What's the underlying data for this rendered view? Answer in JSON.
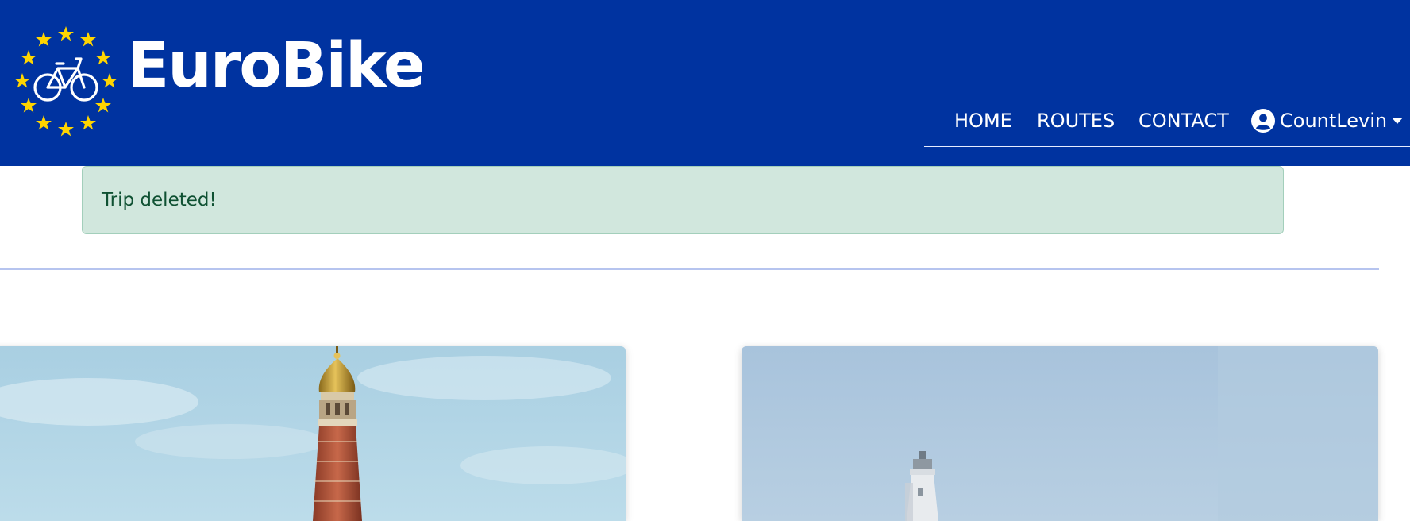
{
  "brand": {
    "name": "EuroBike",
    "logo_icon": "bicycle-in-eu-stars-icon",
    "colors": {
      "header_bg": "#0033a0",
      "stars": "#ffd500"
    }
  },
  "nav": {
    "home": "HOME",
    "routes": "ROUTES",
    "contact": "CONTACT",
    "user_name": "CountLevin",
    "user_icon": "user-circle-icon",
    "dropdown_icon": "caret-down-icon"
  },
  "alert": {
    "message": "Trip deleted!",
    "colors": {
      "bg": "#d1e7dd",
      "border": "#a3cfbb",
      "text": "#0f5132"
    }
  },
  "cards": [
    {
      "image": "st-basils-cathedral-dome"
    },
    {
      "image": "lighthouse-tower"
    }
  ]
}
